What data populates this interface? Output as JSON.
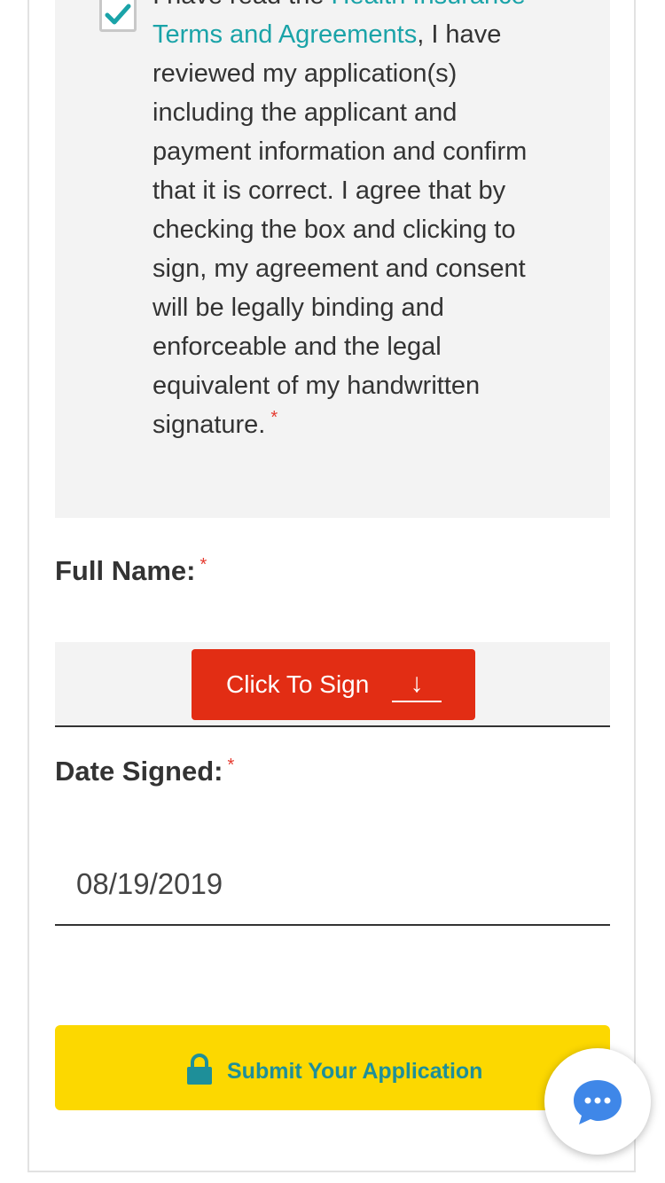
{
  "agreement": {
    "checked": true,
    "text_prefix": "I have read the ",
    "link_text": "Health Insurance Terms and Agreements",
    "text_body": ", I have reviewed my application(s) including the applicant and payment information and confirm that it is correct. I agree that by checking the box and clicking to sign, my agreement and consent will be legally binding and enforceable and the legal equivalent of my handwritten signature.",
    "required_mark": "*"
  },
  "full_name": {
    "label": "Full Name:",
    "required_mark": "*",
    "sign_button_label": "Click To Sign",
    "sign_button_arrow": "↓"
  },
  "date_signed": {
    "label": "Date Signed:",
    "required_mark": "*",
    "value": "08/19/2019"
  },
  "submit": {
    "label": "Submit Your Application",
    "icon": "lock-icon"
  },
  "chat": {
    "icon": "chat-bubble-icon"
  },
  "colors": {
    "link": "#1aa3a8",
    "required": "#e53a2f",
    "sign_button": "#e22d14",
    "submit_button": "#fcd800",
    "submit_text": "#1e8f99",
    "chat_icon": "#3f87e8"
  }
}
